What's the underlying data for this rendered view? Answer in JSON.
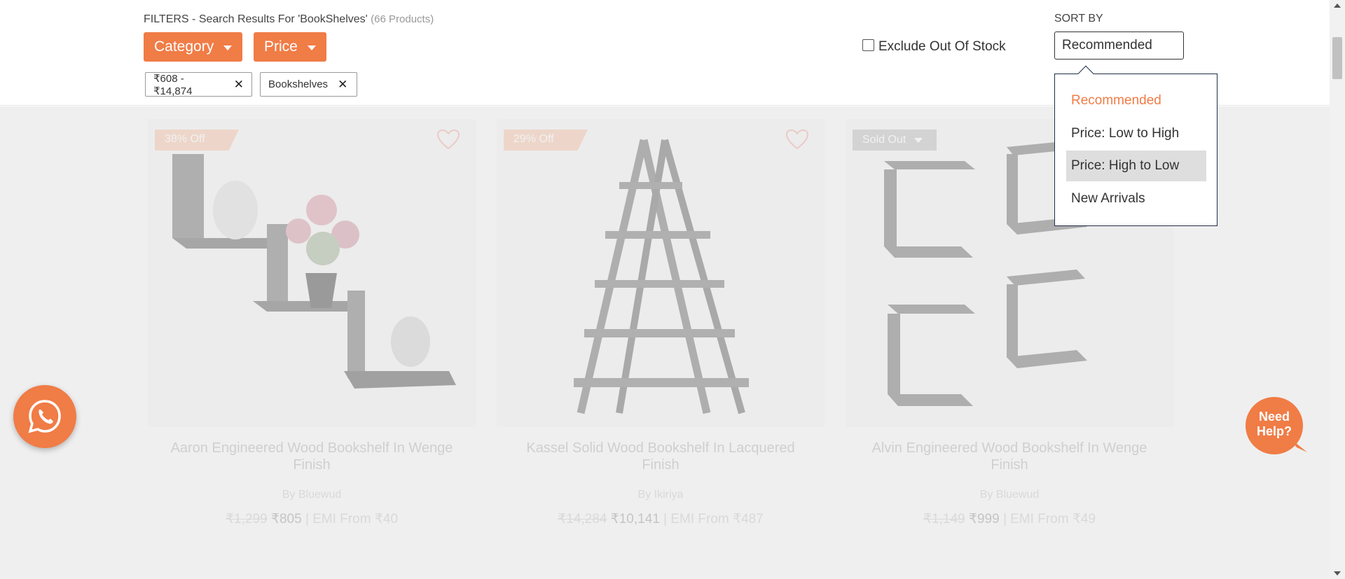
{
  "filters": {
    "title": "FILTERS - Search Results For 'BookShelves'",
    "count": "(66 Products)",
    "category_label": "Category",
    "price_label": "Price",
    "chips": [
      {
        "label": "₹608 - ₹14,874"
      },
      {
        "label": "Bookshelves"
      }
    ],
    "exclude_label": "Exclude Out Of Stock"
  },
  "sort": {
    "label": "SORT BY",
    "selected": "Recommended",
    "options": [
      {
        "label": "Recommended",
        "state": "active"
      },
      {
        "label": "Price: Low to High",
        "state": ""
      },
      {
        "label": "Price: High to Low",
        "state": "hover"
      },
      {
        "label": "New Arrivals",
        "state": ""
      }
    ]
  },
  "products": [
    {
      "badge": "38% Off",
      "title": "Aaron Engineered Wood Bookshelf In Wenge Finish",
      "brand": "By Bluewud",
      "mrp": "₹1,299",
      "price": "₹805",
      "emi": "| EMI From ₹40"
    },
    {
      "badge": "29% Off",
      "title": "Kassel Solid Wood Bookshelf In Lacquered Finish",
      "brand": "By Ikiriya",
      "mrp": "₹14,284",
      "price": "₹10,141",
      "emi": "| EMI From ₹487"
    },
    {
      "badge": "Sold Out",
      "title": "Alvin Engineered Wood Bookshelf In Wenge Finish",
      "brand": "By Bluewud",
      "mrp": "₹1,149",
      "price": "₹999",
      "emi": "| EMI From ₹49"
    }
  ],
  "help": {
    "label": "Need Help?"
  },
  "colors": {
    "accent": "#f07c46",
    "dropdown_border": "#1e2f4a"
  }
}
